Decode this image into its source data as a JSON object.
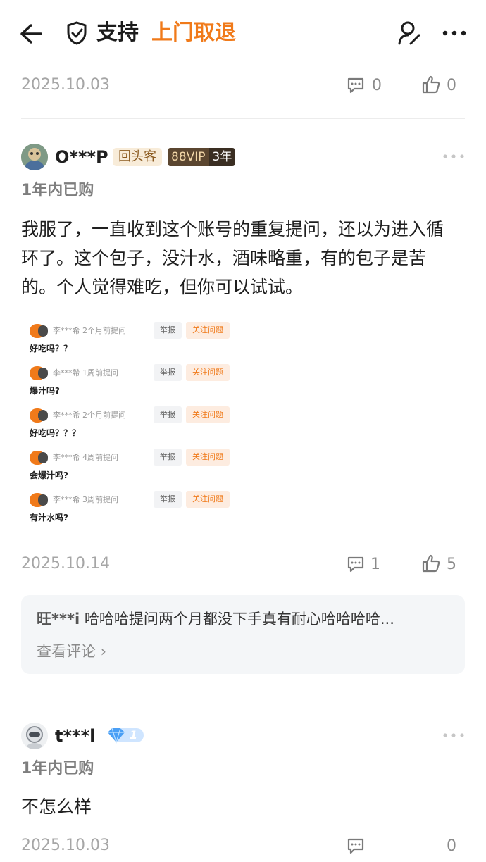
{
  "header": {
    "title": "支持",
    "subtitle": "上门取退"
  },
  "prev_review": {
    "date": "2025.10.03",
    "comment_count": "0",
    "like_count": "0"
  },
  "review1": {
    "user": "O***P",
    "badge_repeat": "回头客",
    "badge_vip": "88VIP",
    "badge_years": "3年",
    "purchase": "1年内已购",
    "text": "我服了，一直收到这个账号的重复提问，还以为进入循环了。这个包子，没汁水，酒味略重，有的包子是苦的。个人觉得难吃，但你可以试试。",
    "questions": [
      {
        "asker": "李***希",
        "time": "2个月前提问",
        "question": "好吃吗？？"
      },
      {
        "asker": "李***希",
        "time": "1周前提问",
        "question": "爆汁吗?"
      },
      {
        "asker": "李***希",
        "time": "2个月前提问",
        "question": "好吃吗？？？"
      },
      {
        "asker": "李***希",
        "time": "4周前提问",
        "question": "会爆汁吗?"
      },
      {
        "asker": "李***希",
        "time": "3周前提问",
        "question": "有汁水吗?"
      }
    ],
    "report_label": "举报",
    "follow_label": "关注问题",
    "date": "2025.10.14",
    "comment_count": "1",
    "like_count": "5",
    "top_comment": {
      "user": "旺***i",
      "text": "哈哈哈提问两个月都没下手真有耐心哈哈哈哈...",
      "view_link": "查看评论 ›"
    }
  },
  "review2": {
    "user": "t***l",
    "level": "1",
    "purchase": "1年内已购",
    "text": "不怎么样",
    "date": "2025.10.03",
    "comment_count": "0"
  },
  "colors": {
    "accent": "#f07a1a",
    "text": "#1f1f1f",
    "muted": "#a6a6a6",
    "comment_bg": "#f4f6f8"
  },
  "icons": [
    "back-arrow-icon",
    "shield-check-icon",
    "user-edit-icon",
    "more-icon",
    "comment-icon",
    "thumb-up-icon",
    "diamond-icon"
  ]
}
